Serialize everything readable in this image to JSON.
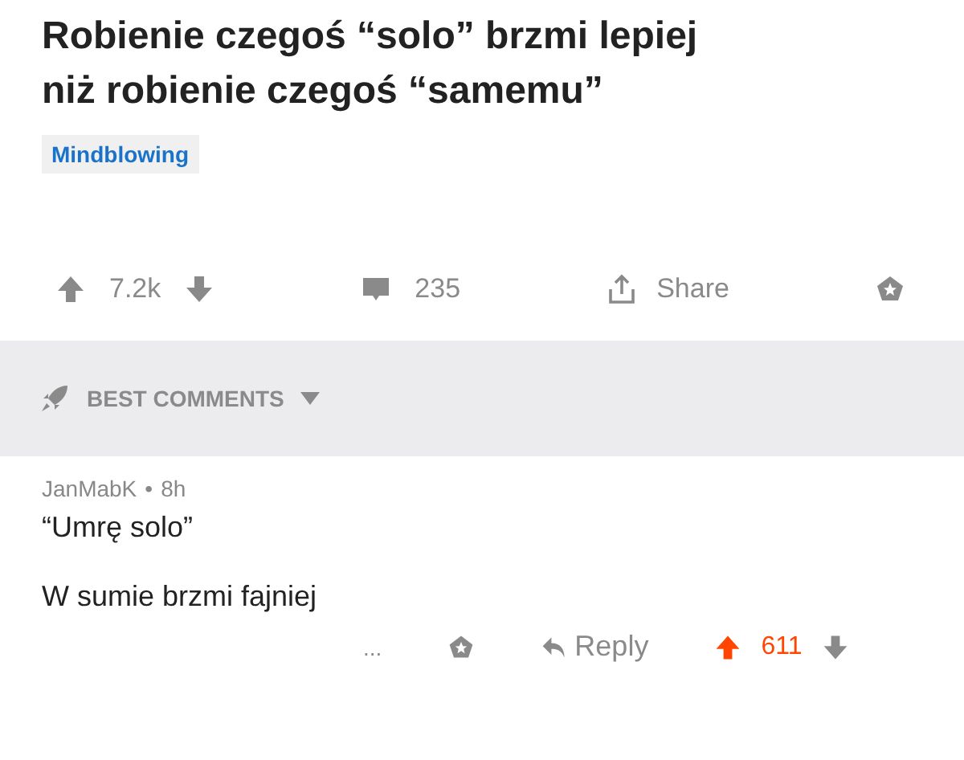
{
  "post": {
    "title_lines": [
      "Robienie czegoś “solo” brzmi lepiej",
      "niż robienie czegoś “samemu”"
    ],
    "tag": "Mindblowing",
    "points": "7.2k",
    "comments": "235",
    "share": "Share"
  },
  "section": {
    "label": "BEST COMMENTS"
  },
  "comment": {
    "author": "JanMabK",
    "separator": "•",
    "time": "8h",
    "lines": [
      "“Umrę solo”",
      "W sumie brzmi fajniej"
    ],
    "more": "...",
    "reply": "Reply",
    "points": "611",
    "upvoted": true
  }
}
